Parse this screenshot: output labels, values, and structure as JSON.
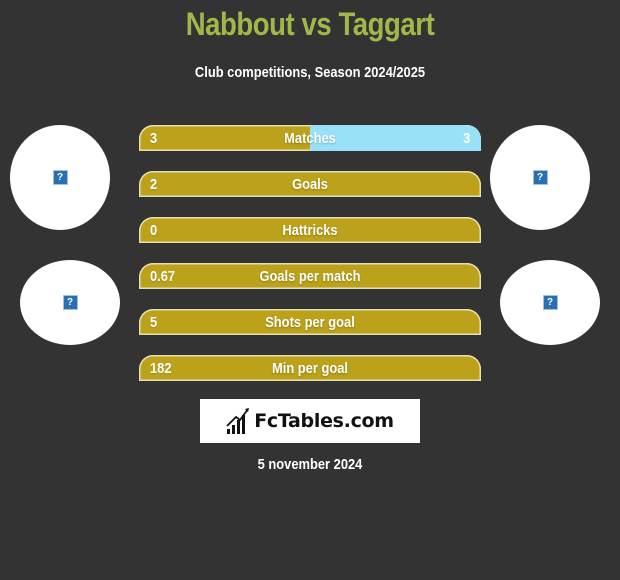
{
  "header": {
    "title": "Nabbout vs Taggart",
    "subtitle": "Club competitions, Season 2024/2025"
  },
  "players": {
    "left": {
      "name": "Nabbout",
      "logo_icon": "broken-image-icon",
      "club_icon": "broken-image-icon"
    },
    "right": {
      "name": "Taggart",
      "logo_icon": "broken-image-icon",
      "club_icon": "broken-image-icon"
    }
  },
  "colors": {
    "background": "#333333",
    "title": "#a0b84a",
    "left_bar": "#bba21a",
    "right_bar": "#99e1f8",
    "text": "#ffffff"
  },
  "stats": [
    {
      "label": "Matches",
      "left": "3",
      "right": "3",
      "right_share": 0.5
    },
    {
      "label": "Goals",
      "left": "2",
      "right": "",
      "right_share": 0
    },
    {
      "label": "Hattricks",
      "left": "0",
      "right": "",
      "right_share": 0
    },
    {
      "label": "Goals per match",
      "left": "0.67",
      "right": "",
      "right_share": 0
    },
    {
      "label": "Shots per goal",
      "left": "5",
      "right": "",
      "right_share": 0
    },
    {
      "label": "Min per goal",
      "left": "182",
      "right": "",
      "right_share": 0
    }
  ],
  "brand": {
    "name": "FcTables.com",
    "icon": "bar-chart-icon"
  },
  "footer": {
    "date": "5 november 2024"
  }
}
